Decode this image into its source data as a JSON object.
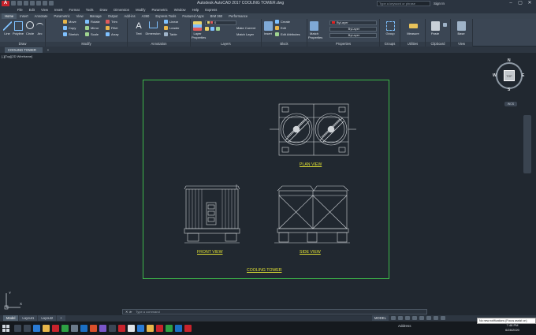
{
  "app": {
    "logo": "A",
    "title": "Autodesk AutoCAD 2017    COOLING TOWER.dwg",
    "search_placeholder": "Type a keyword or phrase",
    "sign_in": "Sign In"
  },
  "menus": [
    "File",
    "Edit",
    "View",
    "Insert",
    "Format",
    "Tools",
    "Draw",
    "Dimension",
    "Modify",
    "Parametric",
    "Window",
    "Help",
    "Express"
  ],
  "ribbon_tabs": [
    {
      "label": "Home",
      "active": true
    },
    {
      "label": "Insert"
    },
    {
      "label": "Annotate"
    },
    {
      "label": "Parametric"
    },
    {
      "label": "View"
    },
    {
      "label": "Manage"
    },
    {
      "label": "Output"
    },
    {
      "label": "Add-ins"
    },
    {
      "label": "A360"
    },
    {
      "label": "Express Tools"
    },
    {
      "label": "Featured Apps"
    },
    {
      "label": "BIM 360"
    },
    {
      "label": "Performance"
    }
  ],
  "ribbon": {
    "draw": {
      "title": "Draw",
      "line": "Line",
      "polyline": "Polyline",
      "circle": "Circle",
      "arc": "Arc"
    },
    "modify": {
      "title": "Modify",
      "move": "Move",
      "rotate": "Rotate",
      "trim": "Trim",
      "copy": "Copy",
      "mirror": "Mirror",
      "fillet": "Fillet",
      "stretch": "Stretch",
      "scale": "Scale",
      "array": "Array"
    },
    "annotation": {
      "title": "Annotation",
      "text": "Text",
      "dimension": "Dimension",
      "linear": "Linear",
      "leader": "Leader",
      "table": "Table"
    },
    "layers": {
      "title": "Layers",
      "layer_properties": "Layer Properties",
      "current_layer": "0",
      "make_current": "Make Current",
      "match_layer": "Match Layer"
    },
    "block": {
      "title": "Block",
      "insert": "Insert",
      "create": "Create",
      "edit": "Edit",
      "edit_attributes": "Edit Attributes"
    },
    "properties": {
      "title": "Properties",
      "match_properties": "Match Properties",
      "color": "ByLayer",
      "linetype": "ByLayer",
      "lineweight": "ByLayer"
    },
    "groups": {
      "title": "Groups",
      "group": "Group"
    },
    "utilities": {
      "title": "Utilities",
      "measure": "Measure"
    },
    "clipboard": {
      "title": "Clipboard",
      "paste": "Paste"
    },
    "view": {
      "title": "View",
      "base": "Base"
    }
  },
  "document_tab": "COOLING TOWER",
  "viewport_label": "[-][Top][2D Wireframe]",
  "drawing": {
    "plan_view": "PLAN VIEW",
    "front_view": "FRONT VIEW",
    "side_view": "SIDE VIEW",
    "title": "COOLING TOWER"
  },
  "viewcube": {
    "top": "TOP",
    "north": "N",
    "south": "S",
    "east": "E",
    "west": "W",
    "wcs": "WCS"
  },
  "ucs": {
    "x": "X",
    "y": "Y"
  },
  "command_placeholder": "Type a command",
  "layout_tabs": [
    {
      "label": "Model",
      "active": true
    },
    {
      "label": "Layout1"
    },
    {
      "label": "Layout2"
    }
  ],
  "status": {
    "model": "MODEL"
  },
  "taskbar": {
    "tray": "Address",
    "time": "7:48 PM",
    "date": "6/28/2020",
    "notification": "No new notifications (Focus assist on)"
  },
  "colors": {
    "background": "#212830",
    "ribbon": "#3b4654",
    "paper_border": "#3db84a",
    "label": "#e0e033",
    "drawing_line": "#d0d4d8",
    "autocad_red": "#c8232c"
  }
}
